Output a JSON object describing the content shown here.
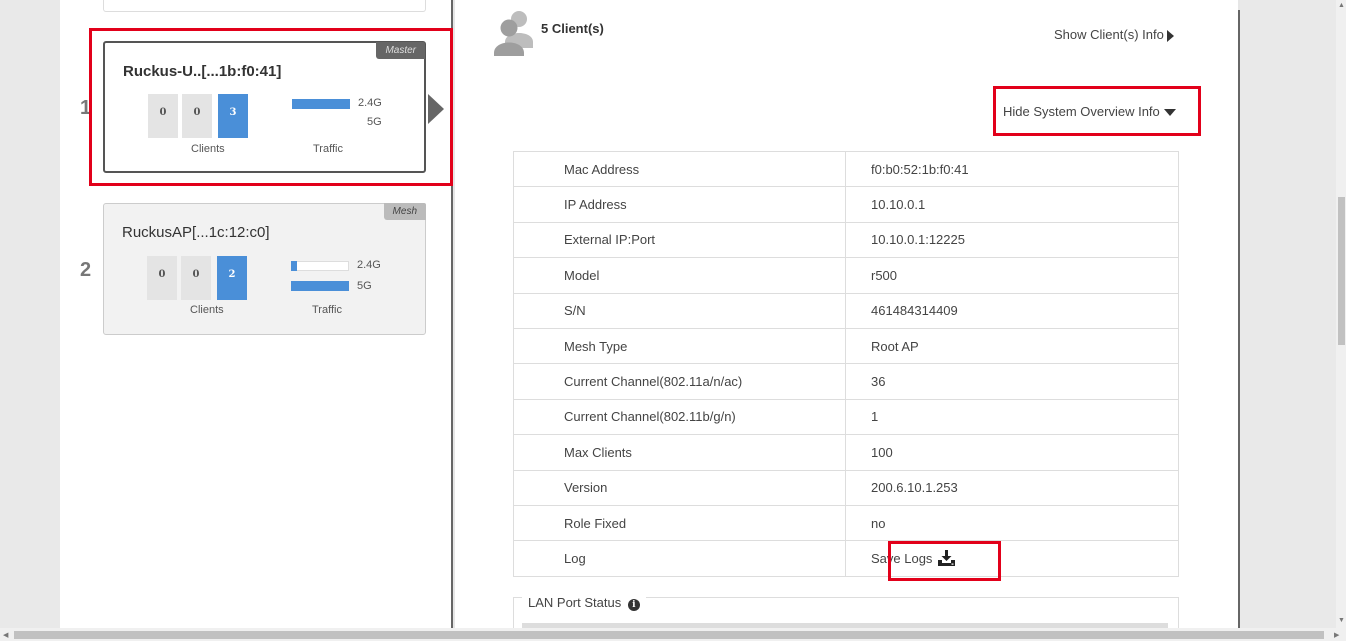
{
  "ap_list": [
    {
      "number": "1",
      "name": "Ruckus-U..[...1b:f0:41]",
      "badge": "Master",
      "client_counts": [
        "0",
        "0",
        "3"
      ],
      "clients_label": "Clients",
      "traffic_label": "Traffic",
      "band_24": "2.4G",
      "band_5": "5G",
      "traffic_24_level": 1.0,
      "traffic_5_level": 0.0
    },
    {
      "number": "2",
      "name": "RuckusAP[...1c:12:c0]",
      "badge": "Mesh",
      "client_counts": [
        "0",
        "0",
        "2"
      ],
      "clients_label": "Clients",
      "traffic_label": "Traffic",
      "band_24": "2.4G",
      "band_5": "5G",
      "traffic_24_level": 0.1,
      "traffic_5_level": 1.0
    }
  ],
  "clients": {
    "title": "5 Client(s)",
    "show_info_label": "Show Client(s) Info",
    "hide_overview_label": "Hide System Overview Info"
  },
  "overview": [
    {
      "key": "Mac Address",
      "value": "f0:b0:52:1b:f0:41"
    },
    {
      "key": "IP Address",
      "value": "10.10.0.1"
    },
    {
      "key": "External IP:Port",
      "value": "10.10.0.1:12225"
    },
    {
      "key": "Model",
      "value": "r500"
    },
    {
      "key": "S/N",
      "value": "461484314409"
    },
    {
      "key": "Mesh Type",
      "value": "Root AP"
    },
    {
      "key": "Current Channel(802.11a/n/ac)",
      "value": "36"
    },
    {
      "key": "Current Channel(802.11b/g/n)",
      "value": "1"
    },
    {
      "key": "Max Clients",
      "value": "100"
    },
    {
      "key": "Version",
      "value": "200.6.10.1.253"
    },
    {
      "key": "Role Fixed",
      "value": "no"
    }
  ],
  "log": {
    "key": "Log",
    "save_label": "Save Logs"
  },
  "lan_port": {
    "title": "LAN Port Status",
    "info_glyph": "i"
  },
  "colors": {
    "accent_blue": "#4a8fd8",
    "highlight_red": "#e2001a"
  },
  "icons": [
    "clients-icon",
    "play-arrow-icon",
    "caret-right-icon",
    "caret-down-icon",
    "download-icon",
    "info-icon"
  ]
}
